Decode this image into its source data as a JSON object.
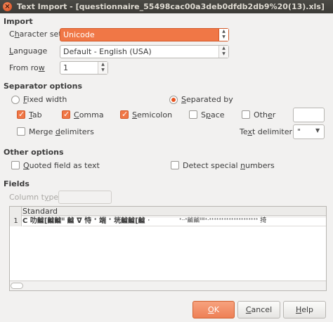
{
  "window": {
    "title": "Text Import - [questionnaire_55498cac00a3deb0dfdb2db9%20(13).xls]"
  },
  "import": {
    "section_title": "Import",
    "charset_label_pre": "C",
    "charset_label_u": "h",
    "charset_label_post": "aracter set",
    "charset_value": "Unicode",
    "language_label_pre": "",
    "language_label_u": "L",
    "language_label_post": "anguage",
    "language_value": "Default - English (USA)",
    "fromrow_label_pre": "From ro",
    "fromrow_label_u": "w",
    "fromrow_label_post": "",
    "fromrow_value": "1"
  },
  "separator": {
    "section_title": "Separator options",
    "fixed_width_pre": "",
    "fixed_width_u": "F",
    "fixed_width_post": "ixed width",
    "separated_by_pre": "",
    "separated_by_u": "S",
    "separated_by_post": "eparated by",
    "tab_pre": "",
    "tab_u": "T",
    "tab_post": "ab",
    "comma_pre": "",
    "comma_u": "C",
    "comma_post": "omma",
    "semicolon_pre": "",
    "semicolon_u": "S",
    "semicolon_post": "emicolon",
    "space_pre": "S",
    "space_u": "p",
    "space_post": "ace",
    "other_pre": "Oth",
    "other_u": "e",
    "other_post": "r",
    "merge_pre": "Merge ",
    "merge_u": "d",
    "merge_post": "elimiters",
    "text_delim_pre": "Te",
    "text_delim_u": "x",
    "text_delim_post": "t delimiter",
    "text_delim_value": "\"",
    "fixed_width_selected": false,
    "separated_by_selected": true,
    "tab_checked": true,
    "comma_checked": true,
    "semicolon_checked": true,
    "space_checked": false,
    "other_checked": false,
    "merge_checked": false
  },
  "other_options": {
    "section_title": "Other options",
    "quoted_pre": "",
    "quoted_u": "Q",
    "quoted_post": "uoted field as text",
    "detect_pre": "Detect special ",
    "detect_u": "n",
    "detect_post": "umbers",
    "quoted_checked": false,
    "detect_checked": false
  },
  "fields": {
    "section_title": "Fields",
    "column_type_pre": "Column t",
    "column_type_u": "y",
    "column_type_post": "pe",
    "column_type_value": "",
    "header": "Standard",
    "row_number": "1",
    "row_text_left": "C 叻𪙫[𪙫𪙫ᐦ 𪙫 ᐁ 恃 ᐩ 端 ᐩ 垙𪙫𪙫[𪙫 ᐧ",
    "row_text_right": "ᐩᐧᐧᐩ𪙫𪙫ᐦᐦᐩᐧᐩᐩᐩᐩᐩᐩᐩᐩᐩᐩᐩᐩᐩᐩᐩᐩᐩᐩᐩᐩ 掎"
  },
  "buttons": {
    "ok_u": "O",
    "ok_post": "K",
    "cancel_pre": "",
    "cancel_u": "C",
    "cancel_post": "ancel",
    "help_pre": "",
    "help_u": "H",
    "help_post": "elp"
  },
  "colors": {
    "accent": "#f07746",
    "titlebar": "#3c3b37",
    "background": "#f2f1f0"
  }
}
